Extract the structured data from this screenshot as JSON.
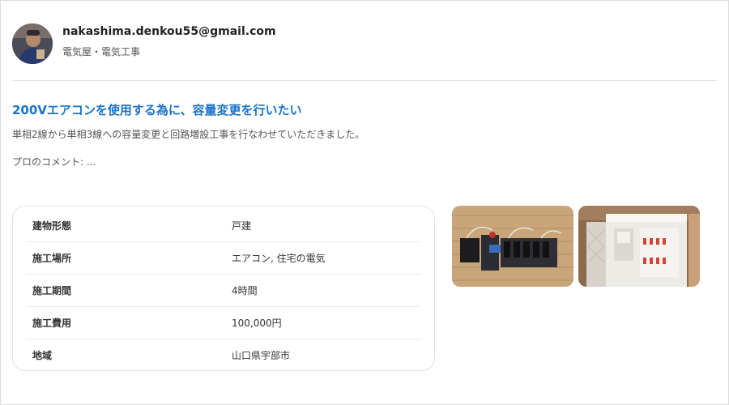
{
  "profile": {
    "email": "nakashima.denkou55@gmail.com",
    "category": "電気屋・電気工事"
  },
  "case": {
    "title": "200Vエアコンを使用する為に、容量変更を行いたい",
    "description": "単相2線から単相3線への容量変更と回路増設工事を行なわせていただきました。",
    "comment": "プロのコメント: ..."
  },
  "details": [
    {
      "label": "建物形態",
      "value": "戸建"
    },
    {
      "label": "施工場所",
      "value": "エアコン, 住宅の電気"
    },
    {
      "label": "施工期間",
      "value": "4時間"
    },
    {
      "label": "施工費用",
      "value": "100,000円"
    },
    {
      "label": "地域",
      "value": "山口県宇部市"
    }
  ]
}
